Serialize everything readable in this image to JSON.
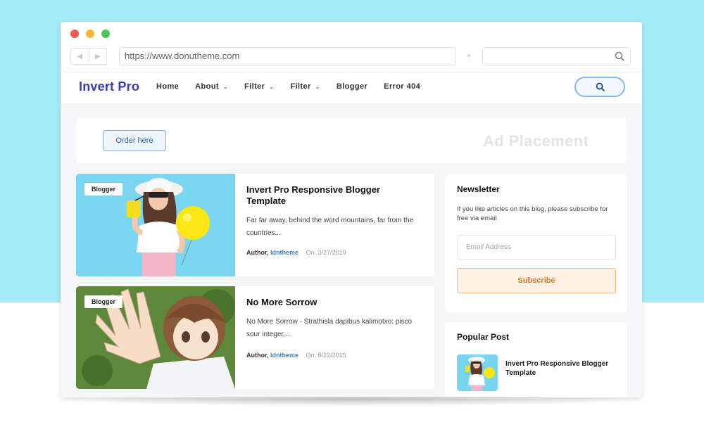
{
  "browser": {
    "url": "https://www.donutheme.com"
  },
  "site": {
    "logo": "Invert Pro",
    "nav": [
      {
        "label": "Home"
      },
      {
        "label": "About"
      },
      {
        "label": "Filter"
      },
      {
        "label": "Filter"
      },
      {
        "label": "Blogger"
      },
      {
        "label": "Error 404"
      }
    ]
  },
  "ad": {
    "button_label": "Order here",
    "placement_label": "Ad Placement"
  },
  "posts": [
    {
      "badge": "Blogger",
      "title": "Invert Pro Responsive Blogger Template",
      "excerpt": "Far far away, behind the word mountains, far from the countries...",
      "author_label": "Author,",
      "author": "Idntheme",
      "date": "On. 3/27/2019"
    },
    {
      "badge": "Blogger",
      "title": "No More Sorrow",
      "excerpt": "No More Sorrow - Strathisla dapibus kalimotxo: pisco sour integer,...",
      "author_label": "Author,",
      "author": "Idntheme",
      "date": "On. 8/22/2015"
    }
  ],
  "newsletter": {
    "title": "Newsletter",
    "description": "If you like articles on this blog, please subscribe for free via email",
    "email_placeholder": "Email Address",
    "subscribe_label": "Subscribe"
  },
  "popular": {
    "title": "Popular Post",
    "items": [
      {
        "title": "Invert Pro Responsive Blogger Template"
      }
    ]
  },
  "colors": {
    "page_background": "#a3ebf7",
    "logo": "#3b39b8",
    "author_link": "#3c7fd8",
    "subscribe_accent": "#d77a2c"
  }
}
